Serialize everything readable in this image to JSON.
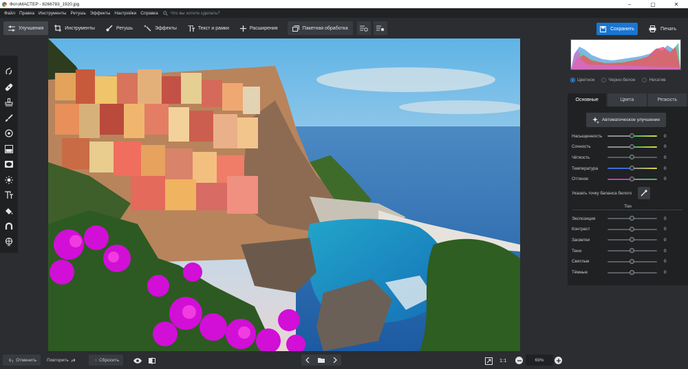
{
  "window": {
    "title": "ФотоМАСТЕР - 8266783_1920.jpg",
    "controls": [
      "minimize-icon",
      "maximize-icon",
      "close-icon"
    ]
  },
  "menu": {
    "items": [
      "Файл",
      "Правка",
      "Инструменты",
      "Ретушь",
      "Эффекты",
      "Настройки",
      "Справка"
    ],
    "search_placeholder": "Что вы хотите сделать?"
  },
  "toolbar": {
    "tabs": [
      {
        "label": "Улучшения",
        "icon": "sliders-icon",
        "active": true
      },
      {
        "label": "Инструменты",
        "icon": "crop-icon",
        "active": false
      },
      {
        "label": "Ретушь",
        "icon": "brush-icon",
        "active": false
      },
      {
        "label": "Эффекты",
        "icon": "magic-wand-icon",
        "active": false
      },
      {
        "label": "Текст и рамки",
        "icon": "text-icon",
        "active": false
      },
      {
        "label": "Расширения",
        "icon": "plus-icon",
        "active": false
      }
    ],
    "batch_label": "Пакетная обработка",
    "save_label": "Сохранить",
    "print_label": "Печать"
  },
  "left_tools": [
    "heal-icon",
    "bandage-icon",
    "stamp-icon",
    "brush-icon",
    "radial-icon",
    "gradient-icon",
    "vignette-icon",
    "light-icon",
    "text-icon",
    "fill-icon",
    "magnet-icon",
    "globe-icon"
  ],
  "panel": {
    "modes": [
      {
        "label": "Цветное",
        "selected": true
      },
      {
        "label": "Черно-белое",
        "selected": false
      },
      {
        "label": "Негатив",
        "selected": false
      }
    ],
    "tabs": [
      {
        "label": "Основные",
        "active": true
      },
      {
        "label": "Цвета",
        "active": false
      },
      {
        "label": "Резкость",
        "active": false
      }
    ],
    "auto_label": "Автоматическое улучшение",
    "color_sliders": [
      {
        "label": "Насыщенность",
        "value": "0",
        "gradient": [
          "#8a8d92",
          "#3fbf4f",
          "#e7d93a"
        ]
      },
      {
        "label": "Сочность",
        "value": "0",
        "gradient": [
          "#8a8d92",
          "#3fbf4f",
          "#e7d93a"
        ]
      },
      {
        "label": "Чёткость",
        "value": "0",
        "gradient": [
          "#5b5e63",
          "#5b5e63",
          "#5b5e63"
        ]
      },
      {
        "label": "Температура",
        "value": "0",
        "gradient": [
          "#3b6bd8",
          "#8a8d92",
          "#e7d93a"
        ]
      },
      {
        "label": "Оттенок",
        "value": "0",
        "gradient": [
          "#c93ab5",
          "#8a8d92",
          "#3fbf4f"
        ]
      }
    ],
    "white_balance_label": "Указать точку баланса белого",
    "tone_title": "Тон",
    "tone_sliders": [
      {
        "label": "Экспозиция",
        "value": "0"
      },
      {
        "label": "Контраст",
        "value": "0"
      },
      {
        "label": "Засветки",
        "value": "0"
      },
      {
        "label": "Тени",
        "value": "0"
      },
      {
        "label": "Светлые",
        "value": "0"
      },
      {
        "label": "Тёмные",
        "value": "0"
      }
    ]
  },
  "bottom": {
    "undo_label": "Отменить",
    "redo_label": "Повторить",
    "reset_label": "Сбросить",
    "ratio_label": "1:1",
    "zoom": "69%"
  },
  "colors": {
    "accent": "#1976d2",
    "background": "#2b2d30",
    "panel_dark": "#1f2123"
  }
}
